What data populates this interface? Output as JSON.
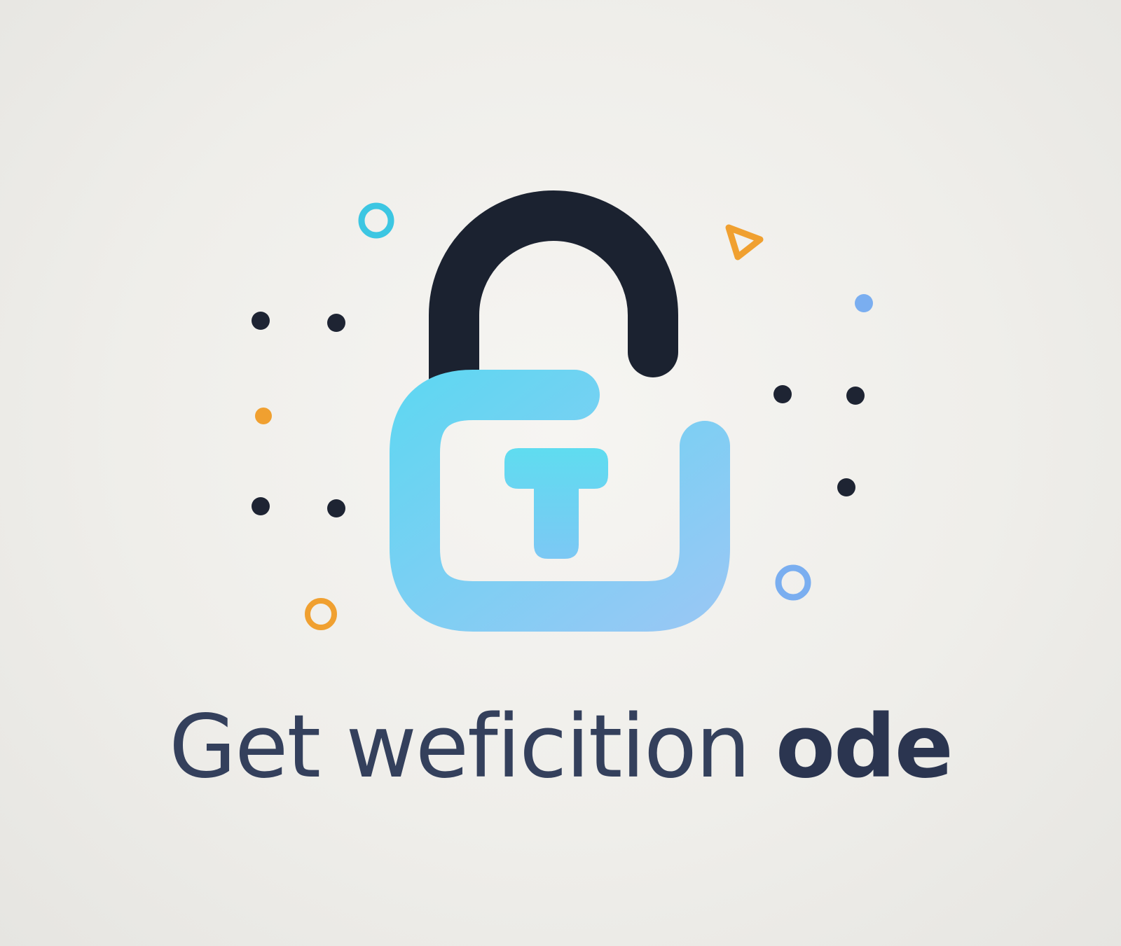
{
  "headline": {
    "regular": "Get weficition",
    "bold": "ode"
  },
  "illustration": {
    "icon": "unlocked-padlock-icon",
    "colors": {
      "shackle": "#1b2230",
      "body": "#7fd3f2",
      "keyhole": "#6fd8f3",
      "dark_dot": "#1e2433",
      "orange": "#f0a030",
      "cyan": "#3cc6e2",
      "blue": "#7aaef0"
    }
  }
}
